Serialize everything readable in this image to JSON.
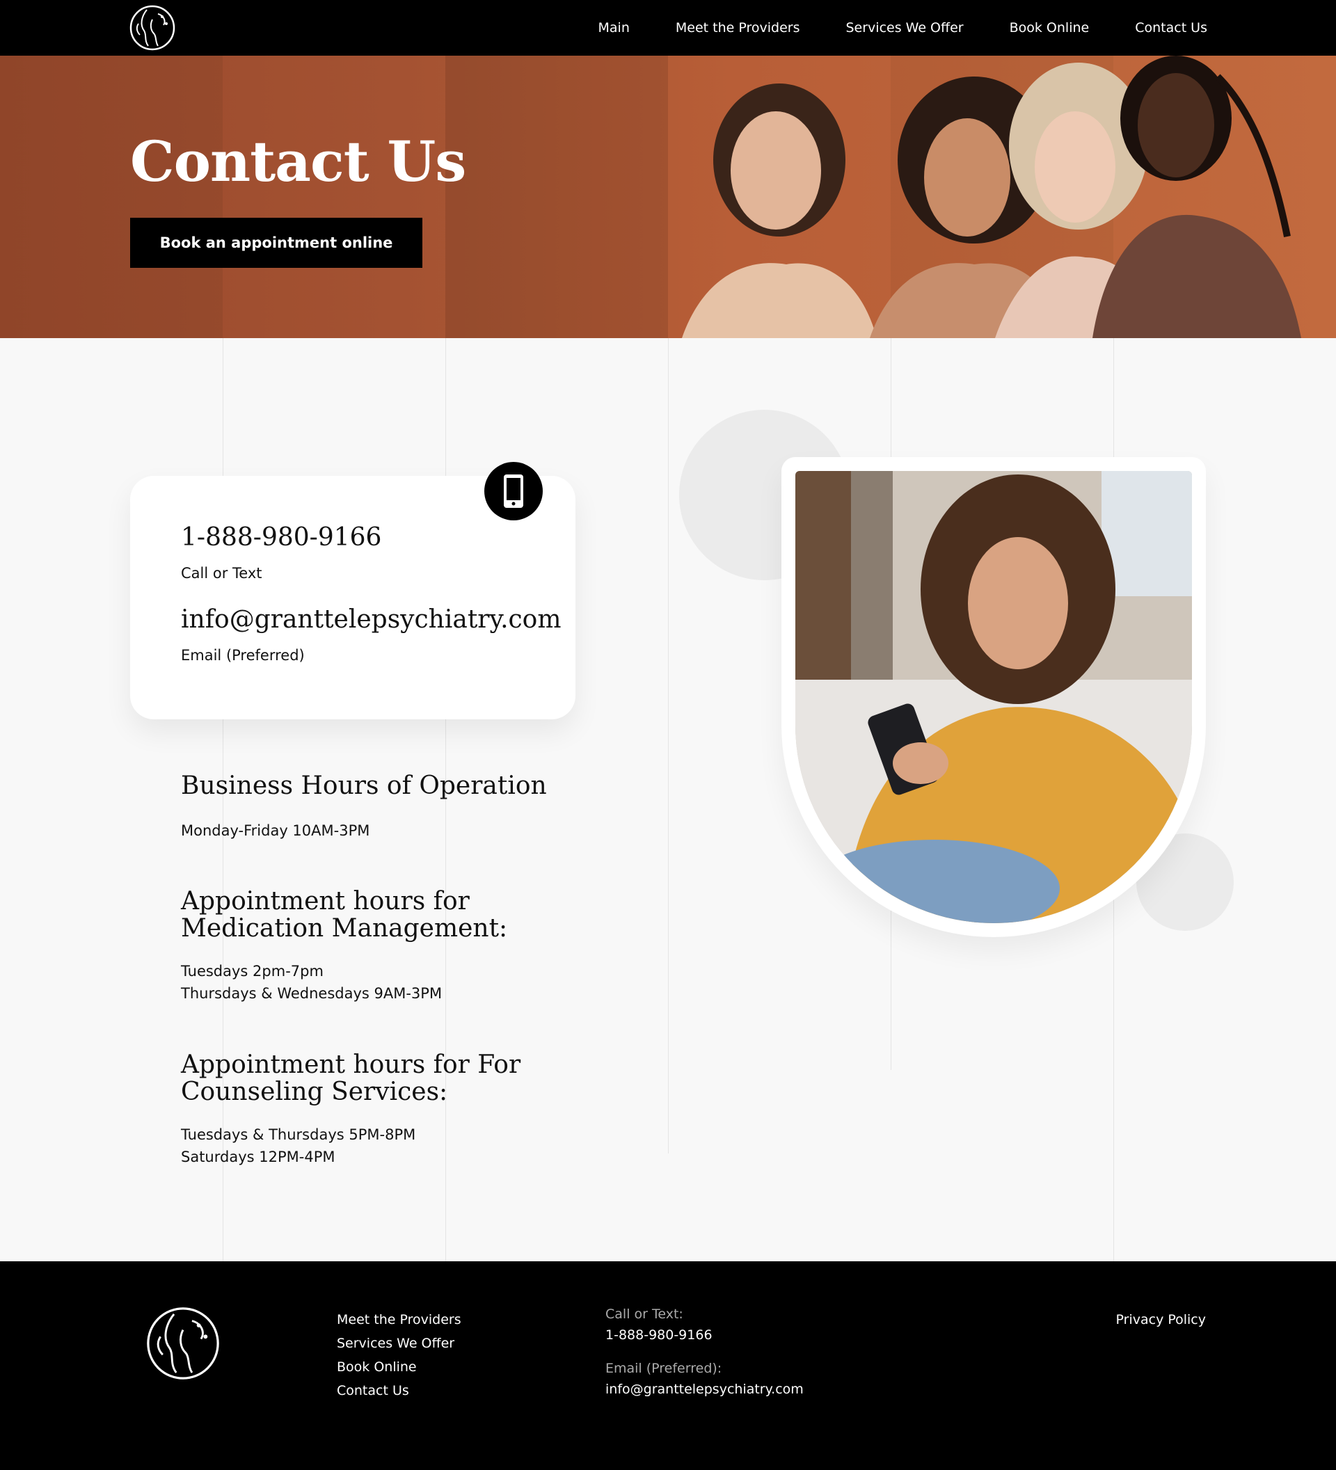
{
  "nav": {
    "items": [
      "Main",
      "Meet the Providers",
      "Services We Offer",
      "Book Online",
      "Contact Us"
    ]
  },
  "hero": {
    "title": "Contact Us",
    "button_label": "Book an appointment online"
  },
  "contact_card": {
    "phone": "1-888-980-9166",
    "phone_caption": "Call or Text",
    "email": "info@granttelepsychiatry.com",
    "email_caption": "Email (Preferred)",
    "icon": "mobile-phone-icon"
  },
  "hours": {
    "business_title": "Business Hours of Operation",
    "business_lines": [
      "Monday-Friday 10AM-3PM"
    ],
    "medication_title_line1": "Appointment hours for",
    "medication_title_line2": "Medication Management:",
    "medication_lines": [
      "Tuesdays 2pm-7pm",
      "Thursdays & Wednesdays 9AM-3PM"
    ],
    "counseling_title_line1": "Appointment hours for For",
    "counseling_title_line2": "Counseling Services:",
    "counseling_lines": [
      "Tuesdays & Thursdays 5PM-8PM",
      "Saturdays 12PM-4PM"
    ]
  },
  "footer": {
    "links": [
      "Meet the Providers",
      "Services We Offer",
      "Book Online",
      "Contact Us"
    ],
    "call_label": "Call or Text:",
    "call_value": "1-888-980-9166",
    "email_label": "Email (Preferred):",
    "email_value": "info@granttelepsychiatry.com",
    "privacy": "Privacy Policy"
  },
  "colors": {
    "hero_bg": "#a45232",
    "header_bg": "#000000",
    "page_bg": "#f8f8f8"
  }
}
